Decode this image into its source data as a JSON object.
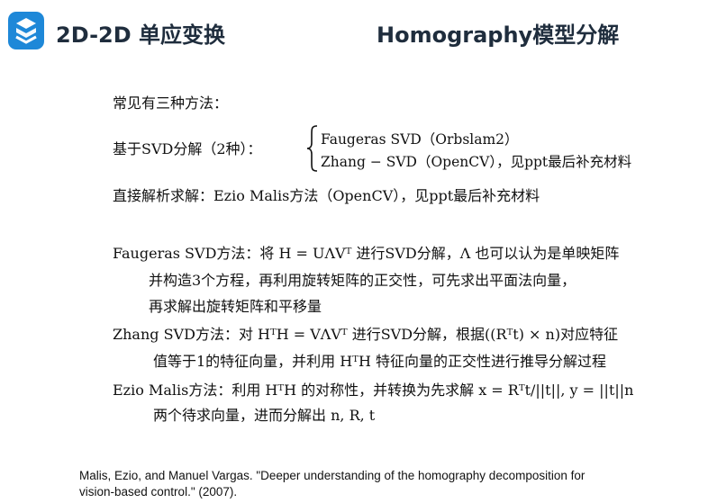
{
  "header": {
    "logo_icon": "brand-logo-icon",
    "title_left": "2D-2D 单应变换",
    "title_right": "Homography模型分解"
  },
  "content": {
    "intro": "常见有三种方法：",
    "svd_label": "基于SVD分解（2种）：",
    "svd_options": [
      "Faugeras SVD（Orbslam2）",
      "Zhang − SVD（OpenCV），见ppt最后补充材料"
    ],
    "direct": "直接解析求解：Ezio Malis方法（OpenCV），见ppt最后补充材料",
    "faugeras_1": "Faugeras SVD方法：将 H = UΛVᵀ 进行SVD分解，Λ 也可以认为是单映矩阵",
    "faugeras_2": "并构造3个方程，再利用旋转矩阵的正交性，可先求出平面法向量，",
    "faugeras_3": "再求解出旋转矩阵和平移量",
    "zhang_1": "Zhang SVD方法：对 HᵀH = VΛVᵀ 进行SVD分解，根据((Rᵀt) × n)对应特征",
    "zhang_2": "值等于1的特征向量，并利用 HᵀH 特征向量的正交性进行推导分解过程",
    "malis_1": "Ezio Malis方法：利用 HᵀH 的对称性，并转换为先求解 x = Rᵀt/||t||, y = ||t||n",
    "malis_2": "两个待求向量，进而分解出 n, R, t"
  },
  "reference": {
    "line1": "Malis, Ezio, and Manuel Vargas. \"Deeper understanding of the homography decomposition for",
    "line2": "vision-based control.\" (2007)."
  },
  "colors": {
    "logo": "#1e88d8",
    "title": "#1f2d3d"
  }
}
